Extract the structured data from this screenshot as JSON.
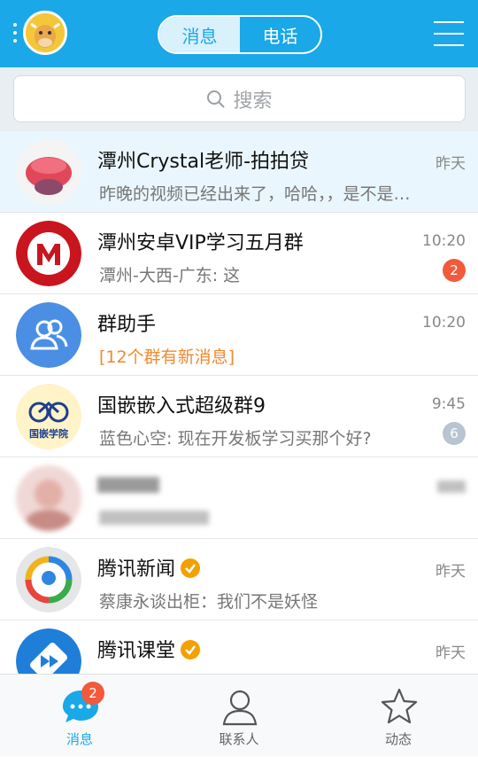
{
  "header": {
    "tabs": [
      {
        "label": "消息",
        "active": true
      },
      {
        "label": "电话",
        "active": false
      }
    ],
    "accent": "#1aa8e8"
  },
  "search": {
    "placeholder": "搜索"
  },
  "conversations": [
    {
      "title": "潭州Crystal老师-拍拍贷",
      "preview": "昨晚的视频已经出来了，哈哈，，是不是…",
      "time": "昨天",
      "highlighted": true
    },
    {
      "title": "潭州安卓VIP学习五月群",
      "preview": "潭州-大西-广东: 这",
      "time": "10:20",
      "badge": "2",
      "badge_color": "#f25a3c"
    },
    {
      "title": "群助手",
      "preview": "[12个群有新消息]",
      "time": "10:20"
    },
    {
      "title": "国嵌嵌入式超级群9",
      "preview": "蓝色心空: 现在开发板学习买那个好?",
      "time": "9:45",
      "badge": "6",
      "badge_color": "#b8c4d0",
      "avatar_text": "国嵌学院"
    },
    {
      "title": "",
      "preview": "",
      "time": "",
      "blurred": true
    },
    {
      "title": "腾讯新闻",
      "preview": "蔡康永谈出柜：我们不是妖怪",
      "time": "昨天",
      "verified": true
    },
    {
      "title": "腾讯课堂",
      "preview": "",
      "time": "昨天",
      "verified": true
    }
  ],
  "bottom_tabs": [
    {
      "label": "消息",
      "icon": "chat-bubble-icon",
      "badge": "2",
      "active": true
    },
    {
      "label": "联系人",
      "icon": "person-icon",
      "active": false
    },
    {
      "label": "动态",
      "icon": "star-icon",
      "active": false
    }
  ]
}
